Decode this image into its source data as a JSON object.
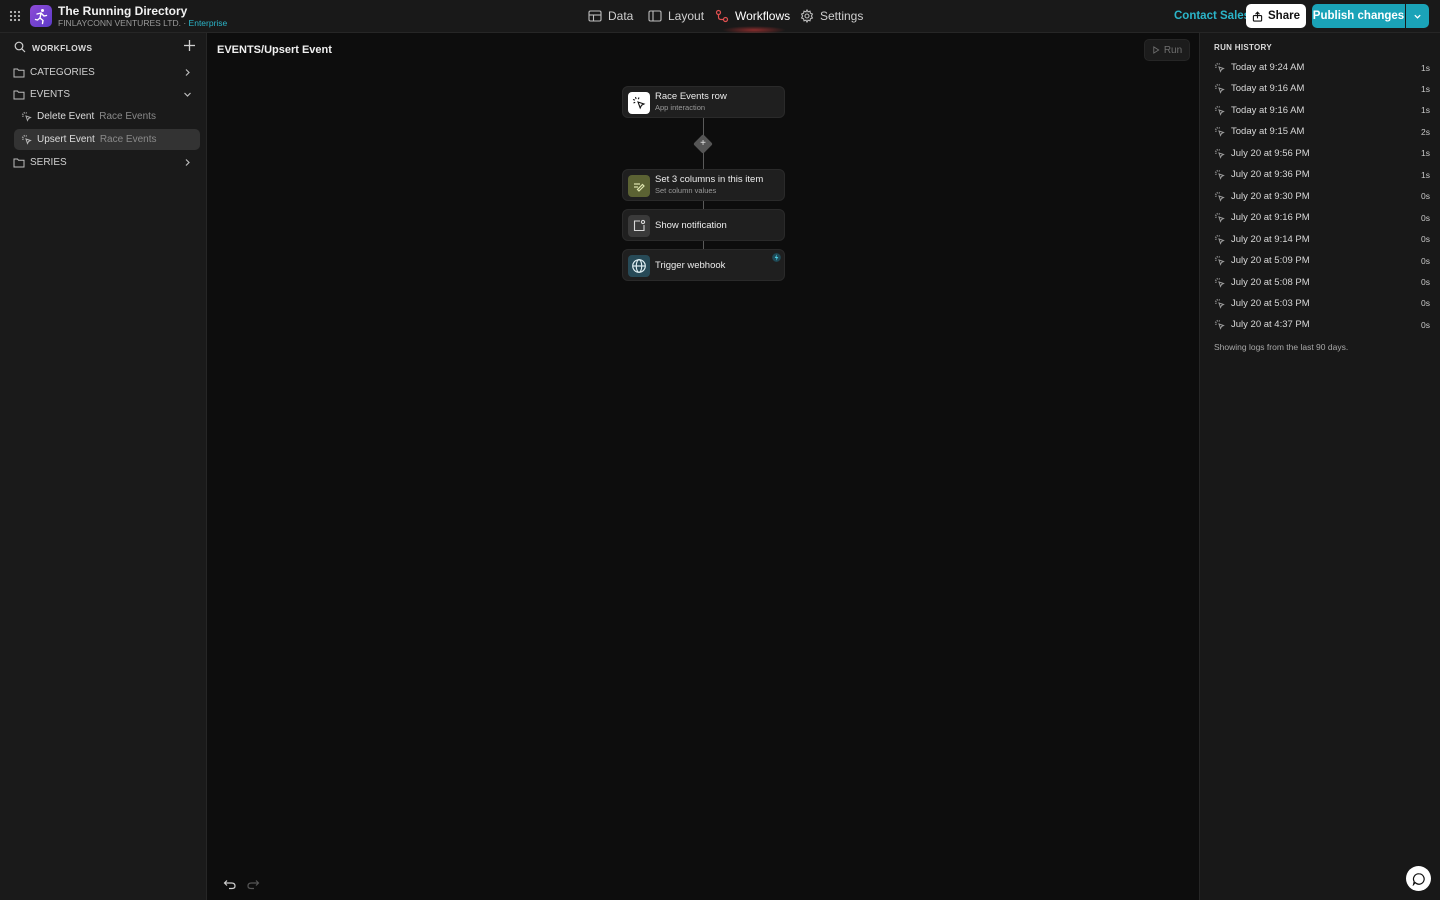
{
  "header": {
    "app_title": "The Running Directory",
    "org_name": "FINLAYCONN VENTURES LTD.",
    "org_separator": "·",
    "plan": "Enterprise",
    "nav": [
      {
        "label": "Data",
        "icon": "table-icon"
      },
      {
        "label": "Layout",
        "icon": "layout-icon"
      },
      {
        "label": "Workflows",
        "icon": "workflow-icon"
      },
      {
        "label": "Settings",
        "icon": "gear-icon"
      }
    ],
    "contact_sales": "Contact Sales",
    "share_label": "Share",
    "publish_label": "Publish changes",
    "accent_color": "#1aa3b8"
  },
  "sidebar": {
    "heading": "WORKFLOWS",
    "folders": [
      {
        "label": "CATEGORIES",
        "expanded": false
      },
      {
        "label": "EVENTS",
        "expanded": true
      },
      {
        "label": "SERIES",
        "expanded": false
      }
    ],
    "workflows": [
      {
        "label": "Delete Event",
        "table": "Race Events",
        "active": false
      },
      {
        "label": "Upsert Event",
        "table": "Race Events",
        "active": true
      }
    ]
  },
  "canvas": {
    "breadcrumb": "EVENTS/Upsert Event",
    "run_label": "Run",
    "nodes": [
      {
        "title": "Race Events row",
        "subtitle": "App interaction",
        "icon": "cursor-click-icon"
      },
      {
        "title": "Set 3 columns in this item",
        "subtitle": "Set column values",
        "icon": "edit-columns-icon"
      },
      {
        "title": "Show notification",
        "subtitle": "",
        "icon": "notification-icon"
      },
      {
        "title": "Trigger webhook",
        "subtitle": "",
        "icon": "globe-icon",
        "badge": "bolt-icon"
      }
    ]
  },
  "run_history": {
    "heading": "RUN HISTORY",
    "runs": [
      {
        "time": "Today at 9:24 AM",
        "duration": "1s"
      },
      {
        "time": "Today at 9:16 AM",
        "duration": "1s"
      },
      {
        "time": "Today at 9:16 AM",
        "duration": "1s"
      },
      {
        "time": "Today at 9:15 AM",
        "duration": "2s"
      },
      {
        "time": "July 20 at 9:56 PM",
        "duration": "1s"
      },
      {
        "time": "July 20 at 9:36 PM",
        "duration": "1s"
      },
      {
        "time": "July 20 at 9:30 PM",
        "duration": "0s"
      },
      {
        "time": "July 20 at 9:16 PM",
        "duration": "0s"
      },
      {
        "time": "July 20 at 9:14 PM",
        "duration": "0s"
      },
      {
        "time": "July 20 at 5:09 PM",
        "duration": "0s"
      },
      {
        "time": "July 20 at 5:08 PM",
        "duration": "0s"
      },
      {
        "time": "July 20 at 5:03 PM",
        "duration": "0s"
      },
      {
        "time": "July 20 at 4:37 PM",
        "duration": "0s"
      }
    ],
    "note": "Showing logs from the last 90 days."
  }
}
